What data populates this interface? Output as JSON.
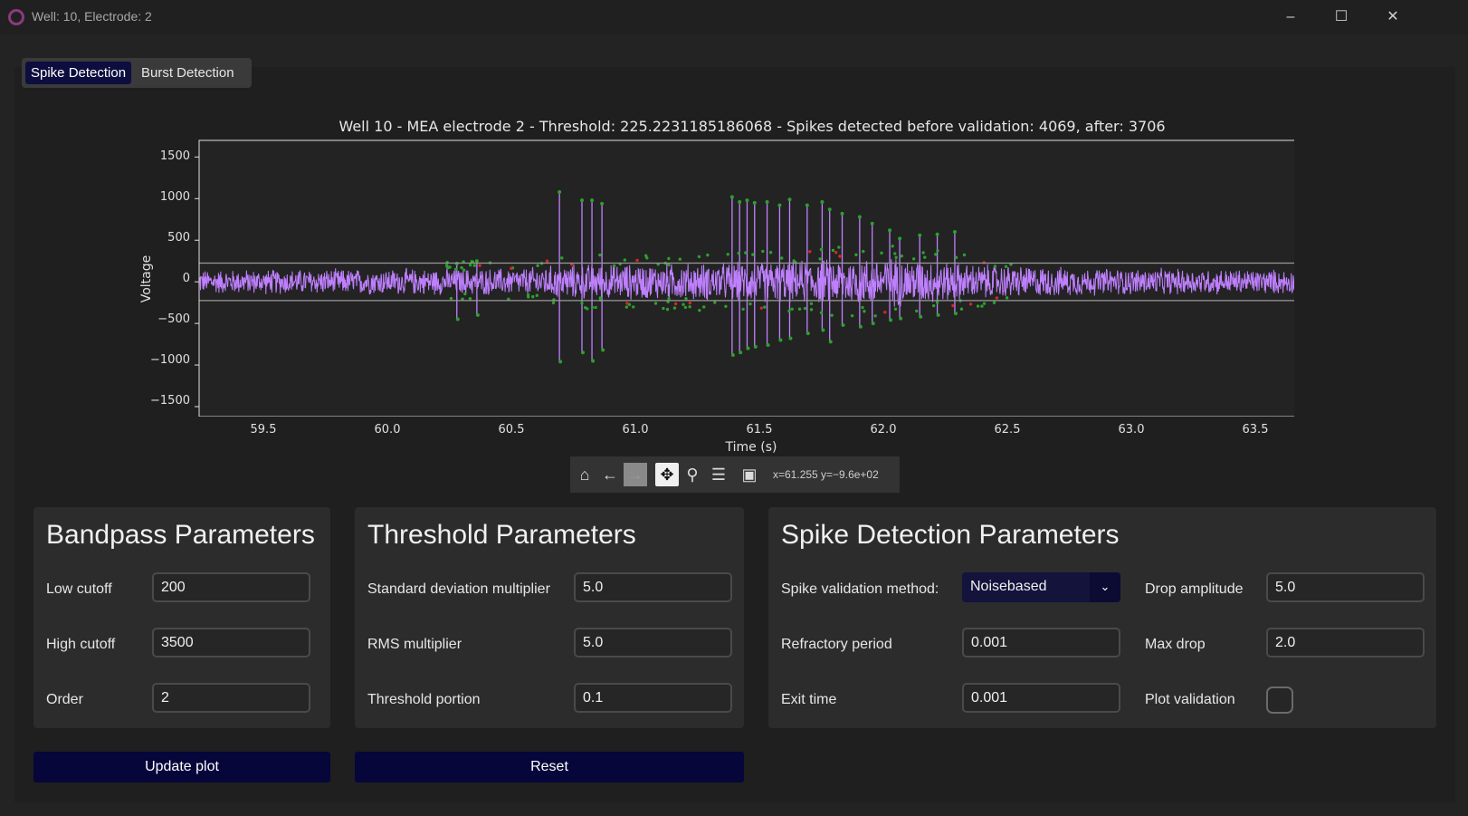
{
  "window": {
    "title": "Well: 10, Electrode: 2",
    "minimize_glyph": "–",
    "maximize_glyph": "☐",
    "close_glyph": "✕"
  },
  "tabs": [
    {
      "label": "Spike Detection",
      "active": true
    },
    {
      "label": "Burst Detection",
      "active": false
    }
  ],
  "plot": {
    "title": "Well 10 - MEA electrode 2 - Threshold: 225.2231185186068 - Spikes detected before validation: 4069, after: 3706",
    "ylabel": "Voltage",
    "xlabel": "Time (s)",
    "yticks": [
      "1500",
      "1000",
      "500",
      "0",
      "−500",
      "−1000",
      "−1500"
    ],
    "xticks": [
      "59.5",
      "60.0",
      "60.5",
      "61.0",
      "61.5",
      "62.0",
      "62.5",
      "63.0",
      "63.5"
    ]
  },
  "chart_data": {
    "type": "line",
    "xlabel": "Time (s)",
    "ylabel": "Voltage",
    "xlim": [
      59.23,
      63.65
    ],
    "ylim": [
      -1620,
      1700
    ],
    "threshold": 225.2231185186068,
    "series_color": "#bf80ff",
    "spike_marker_color": "#2ca02c",
    "rejected_marker_color": "#d62728",
    "spikes": [
      {
        "x": 60.67,
        "up": 1080,
        "down": -960
      },
      {
        "x": 60.76,
        "up": 980,
        "down": -850
      },
      {
        "x": 60.8,
        "up": 980,
        "down": -950
      },
      {
        "x": 60.84,
        "up": 940,
        "down": -820
      },
      {
        "x": 61.36,
        "up": 1020,
        "down": -880
      },
      {
        "x": 61.39,
        "up": 960,
        "down": -850
      },
      {
        "x": 61.42,
        "up": 980,
        "down": -800
      },
      {
        "x": 61.45,
        "up": 950,
        "down": -780
      },
      {
        "x": 61.5,
        "up": 960,
        "down": -760
      },
      {
        "x": 61.55,
        "up": 920,
        "down": -700
      },
      {
        "x": 61.59,
        "up": 990,
        "down": -680
      },
      {
        "x": 61.66,
        "up": 920,
        "down": -620
      },
      {
        "x": 61.72,
        "up": 960,
        "down": -580
      },
      {
        "x": 61.75,
        "up": 870,
        "down": -720
      },
      {
        "x": 61.8,
        "up": 820,
        "down": -520
      },
      {
        "x": 61.87,
        "up": 780,
        "down": -540
      },
      {
        "x": 61.92,
        "up": 700,
        "down": -500
      },
      {
        "x": 61.99,
        "up": 620,
        "down": -460
      },
      {
        "x": 62.03,
        "up": 520,
        "down": -440
      },
      {
        "x": 62.11,
        "up": 560,
        "down": -420
      },
      {
        "x": 62.18,
        "up": 570,
        "down": -400
      },
      {
        "x": 62.25,
        "up": 600,
        "down": -380
      },
      {
        "x": 60.26,
        "up": 220,
        "down": -450
      },
      {
        "x": 60.34,
        "up": 250,
        "down": -400
      }
    ],
    "noise_envelope": [
      {
        "x": 59.23,
        "amp": 160
      },
      {
        "x": 60.5,
        "amp": 180
      },
      {
        "x": 60.7,
        "amp": 230
      },
      {
        "x": 61.3,
        "amp": 250
      },
      {
        "x": 61.75,
        "amp": 300
      },
      {
        "x": 62.0,
        "amp": 330
      },
      {
        "x": 62.3,
        "amp": 240
      },
      {
        "x": 62.8,
        "amp": 180
      },
      {
        "x": 63.65,
        "amp": 160
      }
    ]
  },
  "toolbar": {
    "home_icon": "⌂",
    "back_icon": "←",
    "forward_icon": "→",
    "pan_icon": "✥",
    "zoom_icon": "⚲",
    "configure_icon": "☰",
    "save_icon": "▣",
    "coordinates": "x=61.255 y=−9.6e+02"
  },
  "bandpass": {
    "title": "Bandpass Parameters",
    "low_cutoff_label": "Low cutoff",
    "low_cutoff_value": "200",
    "high_cutoff_label": "High cutoff",
    "high_cutoff_value": "3500",
    "order_label": "Order",
    "order_value": "2"
  },
  "threshold": {
    "title": "Threshold Parameters",
    "std_label": "Standard deviation multiplier",
    "std_value": "5.0",
    "rms_label": "RMS multiplier",
    "rms_value": "5.0",
    "portion_label": "Threshold portion",
    "portion_value": "0.1"
  },
  "spike": {
    "title": "Spike Detection Parameters",
    "method_label": "Spike validation method:",
    "method_value": "Noisebased",
    "method_arrow": "⌄",
    "refractory_label": "Refractory period",
    "refractory_value": "0.001",
    "exit_label": "Exit time",
    "exit_value": "0.001",
    "drop_amp_label": "Drop amplitude",
    "drop_amp_value": "5.0",
    "max_drop_label": "Max drop",
    "max_drop_value": "2.0",
    "plot_validation_label": "Plot validation",
    "plot_validation_checked": false
  },
  "actions": {
    "update_label": "Update plot",
    "reset_label": "Reset"
  }
}
